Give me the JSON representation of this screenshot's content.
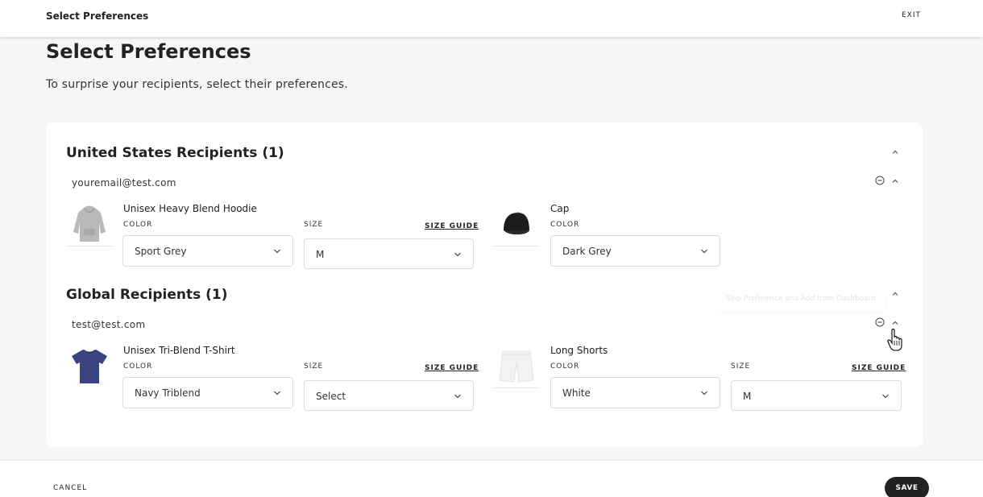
{
  "topbar": {
    "title": "Select Preferences",
    "exit_label": "EXIT"
  },
  "page": {
    "title": "Select Preferences",
    "subtitle": "To surprise your recipients, select their preferences."
  },
  "groups": [
    {
      "title": "United States Recipients (1)",
      "email": "youremail@test.com",
      "products": [
        {
          "name": "Unisex Heavy Blend Hoodie",
          "color_label": "COLOR",
          "color_value": "Sport Grey",
          "size_label": "SIZE",
          "size_guide": "SIZE GUIDE",
          "size_value": "M",
          "thumb_icon": "hoodie-icon",
          "thumb_color": "#b9b9b9"
        },
        {
          "name": "Cap",
          "color_label": "COLOR",
          "color_value": "Dark Grey",
          "thumb_icon": "cap-icon",
          "thumb_color": "#1c1c1c"
        }
      ]
    },
    {
      "title": "Global Recipients (1)",
      "email": "test@test.com",
      "tooltip": "Skip Preference and Add from Dashboard",
      "products": [
        {
          "name": "Unisex Tri-Blend T-Shirt",
          "color_label": "COLOR",
          "color_value": "Navy Triblend",
          "size_label": "SIZE",
          "size_guide": "SIZE GUIDE",
          "size_value": "Select",
          "thumb_icon": "tshirt-icon",
          "thumb_color": "#3a4480"
        },
        {
          "name": "Long Shorts",
          "color_label": "COLOR",
          "color_value": "White",
          "size_label": "SIZE",
          "size_guide": "SIZE GUIDE",
          "size_value": "M",
          "thumb_icon": "shorts-icon",
          "thumb_color": "#f2f2f2"
        }
      ]
    }
  ],
  "footer": {
    "cancel_label": "CANCEL",
    "save_label": "SAVE"
  }
}
